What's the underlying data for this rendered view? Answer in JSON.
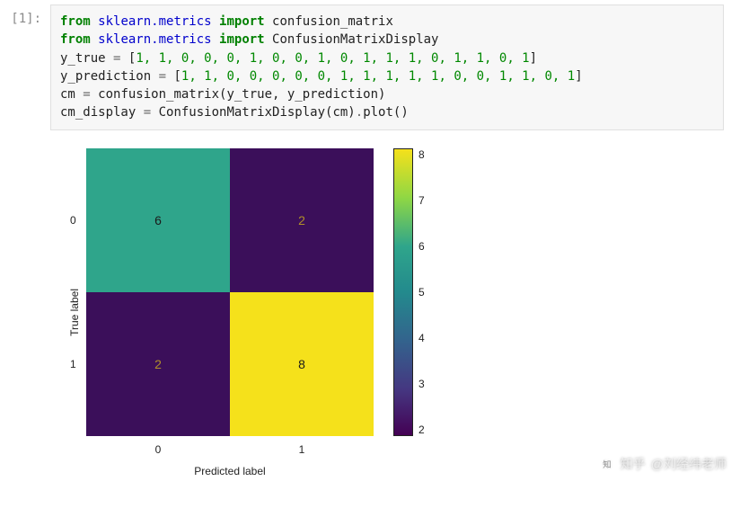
{
  "prompt": "[1]:",
  "code": {
    "l1": {
      "kw1": "from",
      "mod1": "sklearn.metrics",
      "kw2": "import",
      "fn": "confusion_matrix"
    },
    "l2": {
      "kw1": "from",
      "mod1": "sklearn.metrics",
      "kw2": "import",
      "fn": "ConfusionMatrixDisplay"
    },
    "l3": {
      "var": "y_true",
      "eq": " = ",
      "open": "[",
      "vals": "1, 1, 0, 0, 0, 1, 0, 0, 1, 0, 1, 1, 1, 0, 1, 1, 0, 1",
      "close": "]"
    },
    "l4": {
      "var": "y_prediction",
      "eq": " = ",
      "open": "[",
      "vals": "1, 1, 0, 0, 0, 0, 0, 1, 1, 1, 1, 1, 0, 0, 1, 1, 0, 1",
      "close": "]"
    },
    "l5": {
      "var": "cm",
      "eq": " = ",
      "call": "confusion_matrix(y_true, y_prediction)"
    },
    "l6": {
      "var": "cm_display",
      "eq": " = ",
      "a": "ConfusionMatrixDisplay(cm)",
      "dot": ".",
      "b": "plot",
      "par": "()"
    }
  },
  "chart_data": {
    "type": "heatmap",
    "title": "",
    "xlabel": "Predicted label",
    "ylabel": "True label",
    "xticks": [
      "0",
      "1"
    ],
    "yticks": [
      "0",
      "1"
    ],
    "matrix": [
      [
        6,
        2
      ],
      [
        2,
        8
      ]
    ],
    "colorbar_ticks": [
      "8",
      "7",
      "6",
      "5",
      "4",
      "3",
      "2"
    ],
    "vmin": 2,
    "vmax": 8,
    "cells": [
      {
        "val": "6",
        "bg": "#2fa58b",
        "fg": "#1a1a1a"
      },
      {
        "val": "2",
        "bg": "#3b0f5a",
        "fg": "#b08f2a"
      },
      {
        "val": "2",
        "bg": "#3b0f5a",
        "fg": "#b08f2a"
      },
      {
        "val": "8",
        "bg": "#f5e11b",
        "fg": "#1a1a1a"
      }
    ],
    "gradient": "linear-gradient(to bottom,#f5e11b 0%,#8fd744 17%,#2fa58b 34%,#238a8d 50%,#33638d 67%,#453781 84%,#440154 100%)"
  },
  "watermark": {
    "brand": "知乎",
    "user": "@刘经纬老师"
  }
}
